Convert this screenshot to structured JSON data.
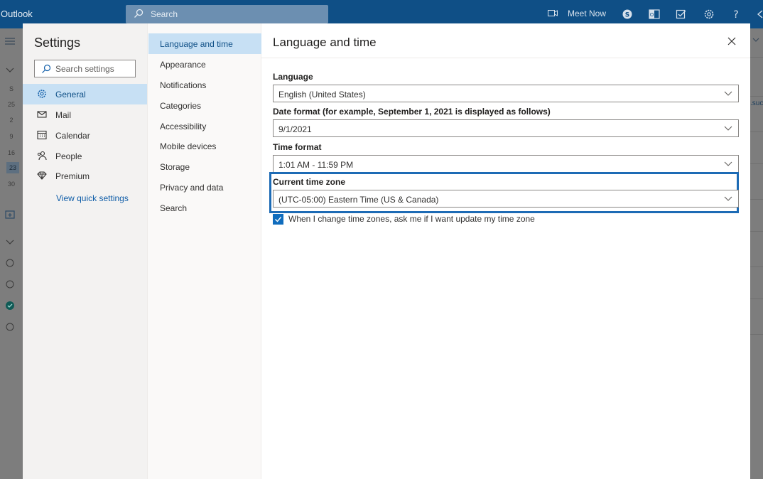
{
  "topbar": {
    "app_name": "Outlook",
    "search_placeholder": "Search",
    "meet_now": "Meet Now",
    "icons": [
      "video-icon",
      "skype-icon",
      "office-icon",
      "tasks-icon",
      "gear-icon",
      "help-icon"
    ]
  },
  "background": {
    "calendar_days": [
      "S",
      "25",
      "2",
      "9",
      "16",
      "23",
      "30"
    ],
    "selected_day": "23",
    "snippet": ".suc ills"
  },
  "settings": {
    "title": "Settings",
    "search_placeholder": "Search settings",
    "categories": [
      {
        "label": "General",
        "icon": "gear-icon",
        "active": true
      },
      {
        "label": "Mail",
        "icon": "mail-icon",
        "active": false
      },
      {
        "label": "Calendar",
        "icon": "calendar-icon",
        "active": false
      },
      {
        "label": "People",
        "icon": "people-icon",
        "active": false
      },
      {
        "label": "Premium",
        "icon": "diamond-icon",
        "active": false
      }
    ],
    "quick_settings_link": "View quick settings",
    "subcategories": [
      {
        "label": "Language and time",
        "active": true
      },
      {
        "label": "Appearance",
        "active": false
      },
      {
        "label": "Notifications",
        "active": false
      },
      {
        "label": "Categories",
        "active": false
      },
      {
        "label": "Accessibility",
        "active": false
      },
      {
        "label": "Mobile devices",
        "active": false
      },
      {
        "label": "Storage",
        "active": false
      },
      {
        "label": "Privacy and data",
        "active": false
      },
      {
        "label": "Search",
        "active": false
      }
    ]
  },
  "panel": {
    "title": "Language and time",
    "language": {
      "label": "Language",
      "value": "English (United States)"
    },
    "date_format": {
      "label": "Date format (for example, September 1, 2021 is displayed as follows)",
      "value": "9/1/2021"
    },
    "time_format": {
      "label": "Time format",
      "value": "1:01 AM - 11:59 PM"
    },
    "time_zone": {
      "label": "Current time zone",
      "value": "(UTC-05:00) Eastern Time (US & Canada)"
    },
    "ask_timezone": {
      "label": "When I change time zones, ask me if I want update my time zone",
      "checked": true
    }
  },
  "colors": {
    "topbar": "#0f4f86",
    "accent": "#0f6cbd",
    "selected": "#c7e0f4",
    "highlight_border": "#1d6bb5"
  }
}
